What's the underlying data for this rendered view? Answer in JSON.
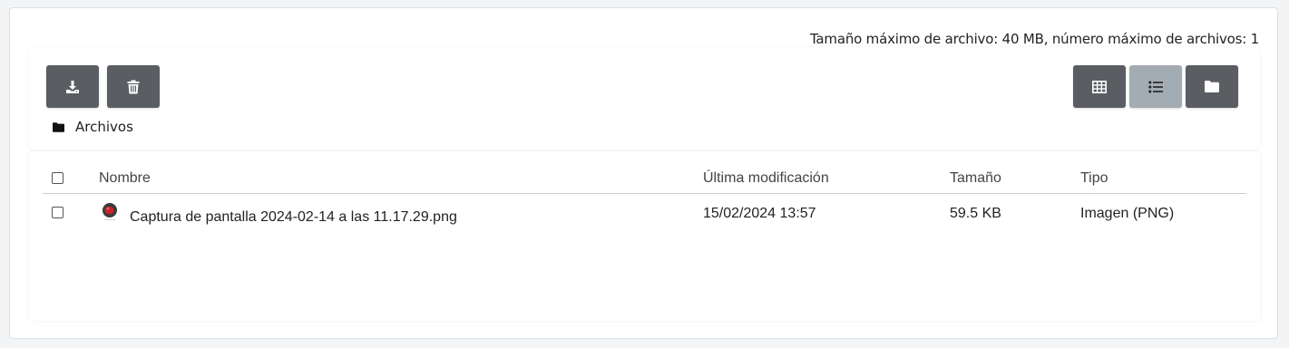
{
  "limits": {
    "text": "Tamaño máximo de archivo: 40 MB, número máximo de archivos: 1"
  },
  "toolbar": {
    "download_icon": "download-icon",
    "delete_icon": "trash-icon"
  },
  "view_modes": {
    "grid_icon": "table-grid-icon",
    "list_icon": "list-icon",
    "tree_icon": "folder-icon",
    "active": "list"
  },
  "breadcrumb": {
    "label": "Archivos",
    "icon": "folder-icon"
  },
  "table": {
    "columns": {
      "name": "Nombre",
      "modified": "Última modificación",
      "size": "Tamaño",
      "type": "Tipo"
    },
    "rows": [
      {
        "name": "Captura de pantalla 2024-02-14 a las 11.17.29.png",
        "modified": "15/02/2024 13:57",
        "size": "59.5 KB",
        "type": "Imagen (PNG)",
        "thumbnail": "image-thumbnail-icon"
      }
    ]
  },
  "colors": {
    "button": "#5a5d61",
    "button_active": "#a3abb3",
    "background": "#f3f4f6"
  }
}
